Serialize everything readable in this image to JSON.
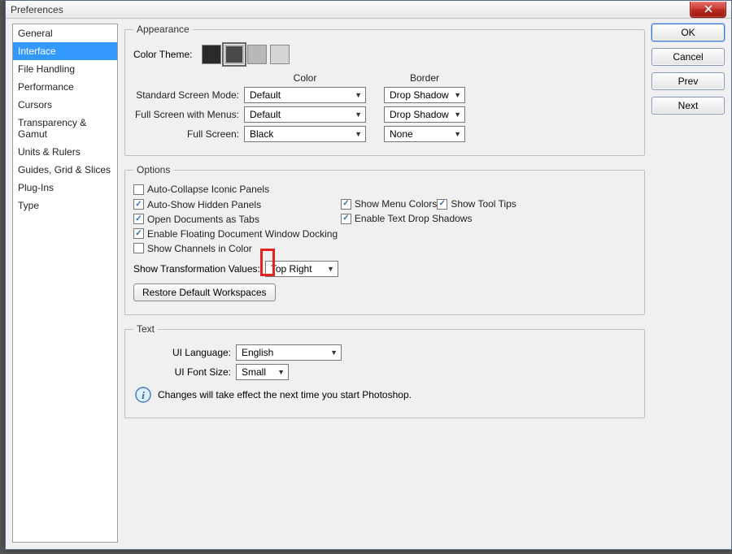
{
  "window": {
    "title": "Preferences"
  },
  "sidebar": {
    "items": [
      {
        "label": "General"
      },
      {
        "label": "Interface",
        "selected": true
      },
      {
        "label": "File Handling"
      },
      {
        "label": "Performance"
      },
      {
        "label": "Cursors"
      },
      {
        "label": "Transparency & Gamut"
      },
      {
        "label": "Units & Rulers"
      },
      {
        "label": "Guides, Grid & Slices"
      },
      {
        "label": "Plug-Ins"
      },
      {
        "label": "Type"
      }
    ]
  },
  "buttons": {
    "ok": "OK",
    "cancel": "Cancel",
    "prev": "Prev",
    "next": "Next"
  },
  "appearance": {
    "legend": "Appearance",
    "color_theme_label": "Color Theme:",
    "themes": [
      {
        "color": "#2b2b2b"
      },
      {
        "color": "#494949",
        "selected": true
      },
      {
        "color": "#b8b8b8"
      },
      {
        "color": "#d6d6d6"
      }
    ],
    "header_color": "Color",
    "header_border": "Border",
    "rows": [
      {
        "label": "Standard Screen Mode:",
        "color": "Default",
        "border": "Drop Shadow"
      },
      {
        "label": "Full Screen with Menus:",
        "color": "Default",
        "border": "Drop Shadow"
      },
      {
        "label": "Full Screen:",
        "color": "Black",
        "border": "None"
      }
    ]
  },
  "options": {
    "legend": "Options",
    "col1": [
      {
        "label": "Auto-Collapse Iconic Panels",
        "checked": false
      },
      {
        "label": "Auto-Show Hidden Panels",
        "checked": true
      },
      {
        "label": "Open Documents as Tabs",
        "checked": true
      },
      {
        "label": "Enable Floating Document Window Docking",
        "checked": true
      },
      {
        "label": "Show Channels in Color",
        "checked": false
      }
    ],
    "col2": [
      {
        "label": "Show Menu Colors",
        "checked": true
      },
      {
        "label": "Show Tool Tips",
        "checked": true
      },
      {
        "label": "Enable Text Drop Shadows",
        "checked": true
      }
    ],
    "transform_label": "Show Transformation Values:",
    "transform_value": "Top Right",
    "restore_btn": "Restore Default Workspaces"
  },
  "text": {
    "legend": "Text",
    "lang_label": "UI Language:",
    "lang_value": "English",
    "font_label": "UI Font Size:",
    "font_value": "Small",
    "info": "Changes will take effect the next time you start Photoshop."
  }
}
